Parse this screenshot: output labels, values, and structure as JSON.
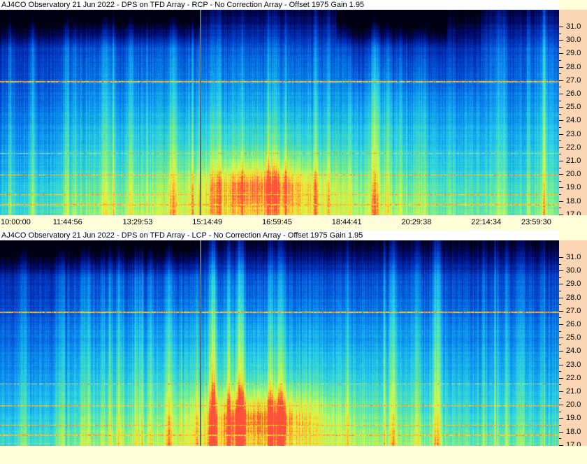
{
  "panels": [
    {
      "title": "AJ4CO Observatory 21 Jun 2022 - DPS on TFD Array  - RCP  -  No Correction Array  -  Offset 1975  Gain 1.95",
      "freq_labels": [
        "31.0",
        "30.0",
        "29.0",
        "28.0",
        "27.0",
        "26.0",
        "25.0",
        "24.0",
        "23.0",
        "22.0",
        "21.0",
        "20.0",
        "19.0",
        "18.0",
        "17.0"
      ]
    },
    {
      "title": "AJ4CO Observatory 21 Jun 2022 - DPS on TFD Array  - LCP  -  No Correction Array  -  Offset 1975  Gain 1.95",
      "freq_labels": [
        "31.0",
        "30.0",
        "29.0",
        "28.0",
        "27.0",
        "26.0",
        "25.0",
        "24.0",
        "23.0",
        "22.0",
        "21.0",
        "20.0",
        "19.0",
        "18.0",
        "17.0"
      ]
    }
  ],
  "time_labels": [
    "10:00:00",
    "11:44:56",
    "13:29:53",
    "15:14:49",
    "16:59:45",
    "18:44:41",
    "20:29:38",
    "22:14:34",
    "23:59:30"
  ],
  "colors": {
    "background": "#fffed8",
    "freq_axis": "#fbd6b5",
    "marker": "#5a6e7a"
  }
}
